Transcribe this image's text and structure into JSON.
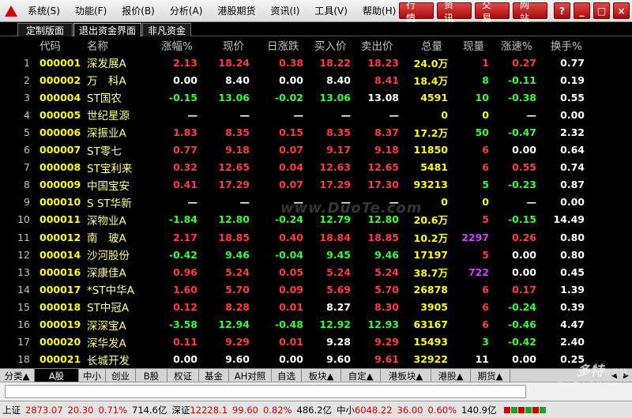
{
  "menu": {
    "items": [
      "系统(S)",
      "功能(F)",
      "报价(B)",
      "分析(A)",
      "港股期货",
      "资讯(I)",
      "工具(V)",
      "帮助(H)"
    ],
    "right_buttons": [
      "行 情",
      "资 讯",
      "交 易",
      "网 站"
    ],
    "window_controls": [
      "?",
      "_",
      "□",
      "×"
    ]
  },
  "tabs": [
    "定制版面",
    "退出资金界面",
    "非凡资金"
  ],
  "table": {
    "headers": [
      "代码",
      "名称",
      "涨幅%",
      "现价",
      "日涨跌",
      "买入价",
      "卖出价",
      "总量",
      "现量",
      "涨速%",
      "换手%"
    ],
    "rows": [
      {
        "idx": "1",
        "code": "000001",
        "name": "深发展A",
        "chg_pct": "2.13",
        "price": "18.24",
        "chg": "0.38",
        "bid": "18.22",
        "ask": "18.23",
        "vol": "24.0万",
        "cur": "1",
        "speed": "0.27",
        "turn": "0.77",
        "c": [
          "red",
          "red",
          "red",
          "red",
          "red",
          "yellow",
          "red",
          "red"
        ]
      },
      {
        "idx": "2",
        "code": "000002",
        "name": "万　科A",
        "chg_pct": "0.00",
        "price": "8.40",
        "chg": "0.00",
        "bid": "8.40",
        "ask": "8.41",
        "vol": "18.4万",
        "cur": "8",
        "speed": "-0.11",
        "turn": "0.19",
        "c": [
          "white",
          "white",
          "white",
          "white",
          "red",
          "yellow",
          "green",
          "green"
        ]
      },
      {
        "idx": "3",
        "code": "000004",
        "name": "ST国农",
        "chg_pct": "-0.15",
        "price": "13.06",
        "chg": "-0.02",
        "bid": "13.06",
        "ask": "13.08",
        "vol": "4591",
        "cur": "10",
        "speed": "-0.38",
        "turn": "0.55",
        "c": [
          "green",
          "green",
          "green",
          "green",
          "white",
          "yellow",
          "green",
          "green"
        ]
      },
      {
        "idx": "4",
        "code": "000005",
        "name": "世纪星源",
        "chg_pct": "—",
        "price": "—",
        "chg": "—",
        "bid": "—",
        "ask": "—",
        "vol": "0",
        "cur": "0",
        "speed": "—",
        "turn": "0.00",
        "c": [
          "white",
          "white",
          "white",
          "white",
          "white",
          "yellow",
          "yellow",
          "white"
        ]
      },
      {
        "idx": "5",
        "code": "000006",
        "name": "深振业A",
        "chg_pct": "1.83",
        "price": "8.35",
        "chg": "0.15",
        "bid": "8.35",
        "ask": "8.37",
        "vol": "17.2万",
        "cur": "50",
        "speed": "-0.47",
        "turn": "2.32",
        "c": [
          "red",
          "red",
          "red",
          "red",
          "red",
          "yellow",
          "green",
          "green"
        ]
      },
      {
        "idx": "6",
        "code": "000007",
        "name": "ST零七",
        "chg_pct": "0.77",
        "price": "9.18",
        "chg": "0.07",
        "bid": "9.17",
        "ask": "9.18",
        "vol": "11850",
        "cur": "6",
        "speed": "0.00",
        "turn": "0.64",
        "c": [
          "red",
          "red",
          "red",
          "red",
          "red",
          "yellow",
          "red",
          "white"
        ]
      },
      {
        "idx": "7",
        "code": "000008",
        "name": "ST宝利来",
        "chg_pct": "0.32",
        "price": "12.65",
        "chg": "0.04",
        "bid": "12.63",
        "ask": "12.65",
        "vol": "5481",
        "cur": "6",
        "speed": "0.55",
        "turn": "0.74",
        "c": [
          "red",
          "red",
          "red",
          "red",
          "red",
          "yellow",
          "red",
          "red"
        ]
      },
      {
        "idx": "8",
        "code": "000009",
        "name": "中国宝安",
        "chg_pct": "0.41",
        "price": "17.29",
        "chg": "0.07",
        "bid": "17.29",
        "ask": "17.30",
        "vol": "93213",
        "cur": "5",
        "speed": "-0.23",
        "turn": "0.87",
        "c": [
          "red",
          "red",
          "red",
          "red",
          "red",
          "yellow",
          "green",
          "green"
        ]
      },
      {
        "idx": "9",
        "code": "000010",
        "name": "S ST华新",
        "chg_pct": "—",
        "price": "—",
        "chg": "—",
        "bid": "—",
        "ask": "—",
        "vol": "0",
        "cur": "0",
        "speed": "—",
        "turn": "0.00",
        "c": [
          "white",
          "white",
          "white",
          "white",
          "white",
          "yellow",
          "yellow",
          "white"
        ]
      },
      {
        "idx": "10",
        "code": "000011",
        "name": "深物业A",
        "chg_pct": "-1.84",
        "price": "12.80",
        "chg": "-0.24",
        "bid": "12.79",
        "ask": "12.80",
        "vol": "20.6万",
        "cur": "5",
        "speed": "-0.15",
        "turn": "14.49",
        "c": [
          "green",
          "green",
          "green",
          "green",
          "green",
          "yellow",
          "red",
          "green"
        ]
      },
      {
        "idx": "11",
        "code": "000012",
        "name": "南　玻A",
        "chg_pct": "2.17",
        "price": "18.85",
        "chg": "0.40",
        "bid": "18.84",
        "ask": "18.85",
        "vol": "10.2万",
        "cur": "2297",
        "speed": "0.26",
        "turn": "0.80",
        "c": [
          "red",
          "red",
          "red",
          "red",
          "red",
          "yellow",
          "magenta",
          "red"
        ]
      },
      {
        "idx": "12",
        "code": "000014",
        "name": "沙河股份",
        "chg_pct": "-0.42",
        "price": "9.46",
        "chg": "-0.04",
        "bid": "9.45",
        "ask": "9.46",
        "vol": "17197",
        "cur": "5",
        "speed": "0.00",
        "turn": "0.80",
        "c": [
          "green",
          "green",
          "green",
          "green",
          "green",
          "yellow",
          "red",
          "white"
        ]
      },
      {
        "idx": "13",
        "code": "000016",
        "name": "深康佳A",
        "chg_pct": "0.96",
        "price": "5.24",
        "chg": "0.05",
        "bid": "5.24",
        "ask": "5.24",
        "vol": "38.7万",
        "cur": "722",
        "speed": "0.00",
        "turn": "0.45",
        "c": [
          "red",
          "red",
          "red",
          "red",
          "red",
          "yellow",
          "magenta",
          "white"
        ]
      },
      {
        "idx": "14",
        "code": "000017",
        "name": "*ST中华A",
        "chg_pct": "1.60",
        "price": "5.70",
        "chg": "0.09",
        "bid": "5.69",
        "ask": "5.70",
        "vol": "26878",
        "cur": "6",
        "speed": "0.17",
        "turn": "1.39",
        "c": [
          "red",
          "red",
          "red",
          "red",
          "red",
          "yellow",
          "red",
          "red"
        ]
      },
      {
        "idx": "15",
        "code": "000018",
        "name": "ST中冠A",
        "chg_pct": "0.12",
        "price": "8.28",
        "chg": "0.01",
        "bid": "8.27",
        "ask": "8.30",
        "vol": "3905",
        "cur": "6",
        "speed": "-0.24",
        "turn": "0.39",
        "c": [
          "red",
          "red",
          "red",
          "white",
          "red",
          "yellow",
          "red",
          "green"
        ]
      },
      {
        "idx": "16",
        "code": "000019",
        "name": "深深宝A",
        "chg_pct": "-3.58",
        "price": "12.94",
        "chg": "-0.48",
        "bid": "12.92",
        "ask": "12.93",
        "vol": "63167",
        "cur": "6",
        "speed": "-0.46",
        "turn": "4.47",
        "c": [
          "green",
          "green",
          "green",
          "green",
          "green",
          "yellow",
          "red",
          "green"
        ]
      },
      {
        "idx": "17",
        "code": "000020",
        "name": "深华发A",
        "chg_pct": "0.11",
        "price": "9.29",
        "chg": "0.01",
        "bid": "9.28",
        "ask": "9.29",
        "vol": "15493",
        "cur": "3",
        "speed": "-0.42",
        "turn": "2.40",
        "c": [
          "red",
          "red",
          "red",
          "white",
          "red",
          "yellow",
          "green",
          "green"
        ]
      },
      {
        "idx": "18",
        "code": "000021",
        "name": "长城开发",
        "chg_pct": "0.00",
        "price": "9.60",
        "chg": "0.00",
        "bid": "9.60",
        "ask": "9.61",
        "vol": "32922",
        "cur": "11",
        "speed": "0.00",
        "turn": "0.25",
        "c": [
          "white",
          "white",
          "white",
          "white",
          "red",
          "yellow",
          "white",
          "white"
        ]
      }
    ]
  },
  "watermark": "www.DuoTe.com",
  "categories": [
    "分类▲",
    "A股",
    "中小",
    "创业",
    "B股",
    "权证",
    "基金",
    "AH对照",
    "自选",
    "板块▲",
    "自定▲",
    "港板块▲",
    "港股▲",
    "期货▲"
  ],
  "status": {
    "sh_label": "上证",
    "sh_value": "2873.07",
    "sh_chg": "20.30",
    "sh_pct": "0.71%",
    "sh_amount": "714.6亿",
    "sz_label": "深证",
    "sz_value": "12228.1",
    "sz_chg": "99.60",
    "sz_pct": "0.82%",
    "sz_amount": "486.2亿",
    "zx_label": "中小",
    "zx_value": "6048.22",
    "zx_chg": "36.00",
    "zx_pct": "0.60%",
    "zx_amount": "140.9亿"
  },
  "brand": {
    "main": "多特",
    "suffix": "软件站",
    "sub": "国内最安全的软件站"
  },
  "colors": {
    "up": "#ff3b3b",
    "down": "#30ff30",
    "flat": "#ffffff",
    "code": "#ffff00",
    "big": "#d040ff"
  }
}
